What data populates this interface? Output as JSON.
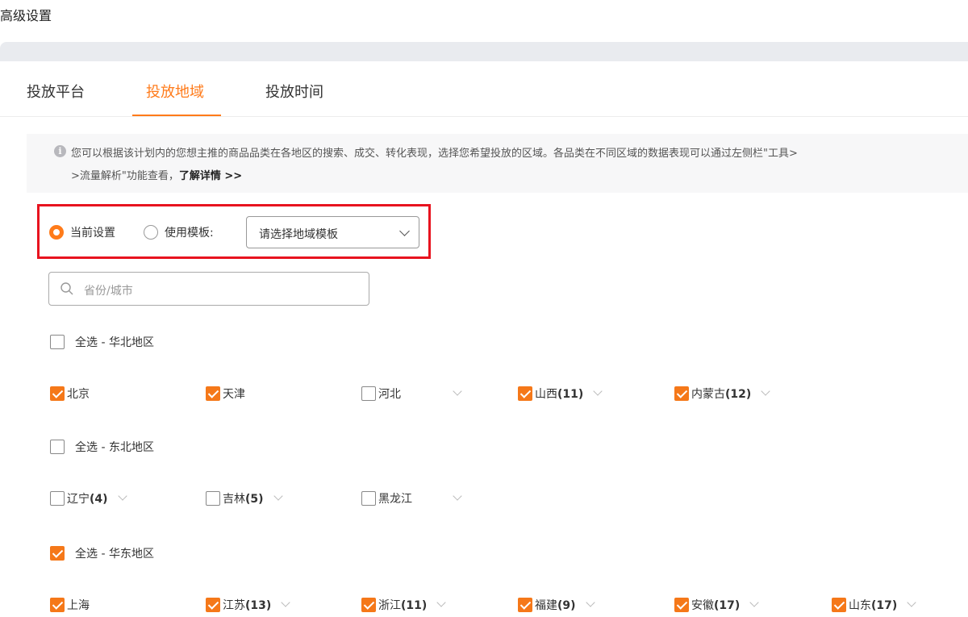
{
  "page_title": "高级设置",
  "tabs": [
    {
      "label": "投放平台",
      "active": false
    },
    {
      "label": "投放地域",
      "active": true
    },
    {
      "label": "投放时间",
      "active": false
    }
  ],
  "notice": {
    "line1": "您可以根据该计划内的您想主推的商品品类在各地区的搜索、成交、转化表现，选择您希望投放的区域。各品类在不同区域的数据表现可以通过左侧栏\"工具>",
    "line2_prefix": ">流量解析\"功能查看，",
    "link": "了解详情 >>"
  },
  "settings": {
    "current_label": "当前设置",
    "template_label": "使用模板:",
    "template_placeholder": "请选择地域模板"
  },
  "search": {
    "placeholder": "省份/城市"
  },
  "regions": [
    {
      "select_all_label": "全选 - 华北地区",
      "all_checked": false,
      "items": [
        {
          "name": "北京",
          "count": "",
          "checked": true,
          "expandable": false
        },
        {
          "name": "天津",
          "count": "",
          "checked": true,
          "expandable": false
        },
        {
          "name": "河北",
          "count": "",
          "checked": false,
          "expandable": true
        },
        {
          "name": "山西",
          "count": "(11)",
          "checked": true,
          "expandable": true
        },
        {
          "name": "内蒙古",
          "count": "(12)",
          "checked": true,
          "expandable": true
        }
      ]
    },
    {
      "select_all_label": "全选 - 东北地区",
      "all_checked": false,
      "items": [
        {
          "name": "辽宁",
          "count": "(4)",
          "checked": false,
          "expandable": true
        },
        {
          "name": "吉林",
          "count": "(5)",
          "checked": false,
          "expandable": true
        },
        {
          "name": "黑龙江",
          "count": "",
          "checked": false,
          "expandable": true
        }
      ]
    },
    {
      "select_all_label": "全选 - 华东地区",
      "all_checked": true,
      "items": [
        {
          "name": "上海",
          "count": "",
          "checked": true,
          "expandable": false
        },
        {
          "name": "江苏",
          "count": "(13)",
          "checked": true,
          "expandable": true
        },
        {
          "name": "浙江",
          "count": "(11)",
          "checked": true,
          "expandable": true
        },
        {
          "name": "福建",
          "count": "(9)",
          "checked": true,
          "expandable": true
        },
        {
          "name": "安徽",
          "count": "(17)",
          "checked": true,
          "expandable": true
        },
        {
          "name": "山东",
          "count": "(17)",
          "checked": true,
          "expandable": true
        }
      ]
    }
  ],
  "colors": {
    "accent": "#ff7b1a",
    "checkbox": "#f57819",
    "highlight": "#e8131f"
  }
}
